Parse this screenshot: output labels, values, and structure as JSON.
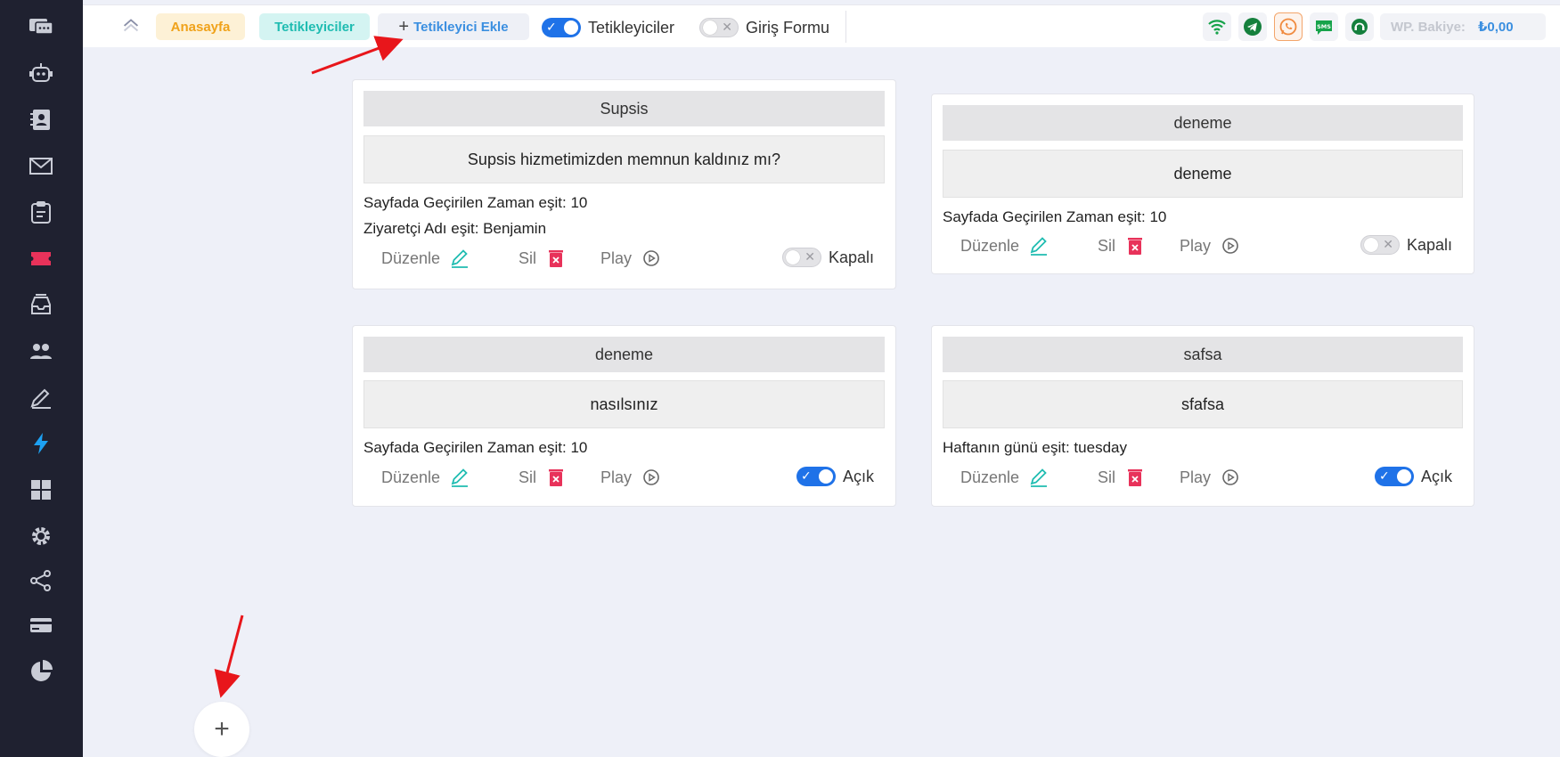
{
  "topbar": {
    "home_label": "Anasayfa",
    "triggers_label": "Tetikleyiciler",
    "add_trigger_label": "Tetikleyici Ekle",
    "toggle_triggers_label": "Tetikleyiciler",
    "toggle_triggers_on": true,
    "toggle_login_form_label": "Giriş Formu",
    "toggle_login_form_on": false,
    "balance_label": "WP. Bakiye:",
    "balance_value": "₺0,00",
    "sms_label": "SMS"
  },
  "card_actions": {
    "edit": "Düzenle",
    "delete": "Sil",
    "play": "Play"
  },
  "cards": [
    {
      "title": "Supsis",
      "message": "Supsis hizmetimizden memnun kaldınız mı?",
      "conditions": [
        "Sayfada Geçirilen Zaman eşit: 10",
        "Ziyaretçi Adı eşit: Benjamin"
      ],
      "status": "Kapalı",
      "enabled": false
    },
    {
      "title": "deneme",
      "message": "deneme",
      "conditions": [
        "Sayfada Geçirilen Zaman eşit: 10"
      ],
      "status": "Kapalı",
      "enabled": false
    },
    {
      "title": "deneme",
      "message": "nasılsınız",
      "conditions": [
        "Sayfada Geçirilen Zaman eşit: 10"
      ],
      "status": "Açık",
      "enabled": true
    },
    {
      "title": "safsa",
      "message": "sfafsa",
      "conditions": [
        "Haftanın günü eşit: tuesday"
      ],
      "status": "Açık",
      "enabled": true
    }
  ],
  "fab_label": "+",
  "colors": {
    "sidebar_bg": "#1f2130",
    "accent_blue": "#1f72e8",
    "active_sidebar": "#e8325a",
    "lightning": "#1da1f2",
    "teal": "#1fbcb1",
    "danger": "#e8325a",
    "annotation_arrow": "#e8161b"
  }
}
